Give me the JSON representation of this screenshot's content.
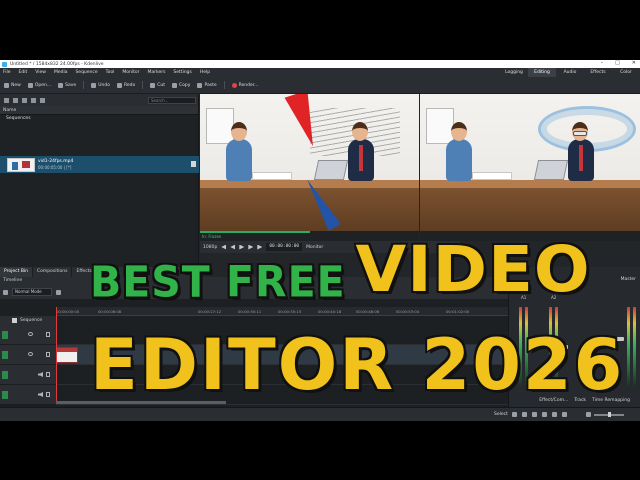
{
  "window": {
    "title": "Untitled * / 1584x832 24.00fps - Kdenlive",
    "controls": [
      "–",
      "□",
      "✕"
    ]
  },
  "menu": [
    "File",
    "Edit",
    "View",
    "Media",
    "Sequence",
    "Tool",
    "Monitor",
    "Markers",
    "Settings",
    "Help"
  ],
  "layouts": {
    "items": [
      "Logging",
      "Editing",
      "Audio",
      "Effects",
      "Color"
    ],
    "active": "Editing"
  },
  "toolbar": {
    "new": "New",
    "open": "Open...",
    "save": "Save",
    "undo": "Undo",
    "redo": "Redo",
    "cut": "Cut",
    "copy": "Copy",
    "paste": "Paste",
    "render": "Render...",
    "render_color": "#e0434b"
  },
  "bin": {
    "search_placeholder": "Search...",
    "column_header": "Name",
    "folder": "Sequences",
    "clip_name": "vid1-24fps.mp4",
    "clip_duration": "00:00:05:00 | [*]"
  },
  "dock_tabs": [
    "Project Bin",
    "Compositions",
    "Effects",
    "Clip Pr..."
  ],
  "monitor": {
    "clip_label": "In: Frozen",
    "progress": 0.5,
    "zoom": "1080p",
    "timecode": "00:00:00:00",
    "tab": "Monitor"
  },
  "timeline": {
    "title": "Timeline",
    "mode": "Normal Mode",
    "sequence": "Sequence",
    "ruler": [
      "00:00:00:00",
      "00:00:08:08",
      "00:00:27:12",
      "00:00:30:11",
      "00:00:35:15",
      "00:00:40:18",
      "00:00:48:06",
      "00:00:53:04",
      "00:01:02:00"
    ],
    "tracks": [
      "V2",
      "V1",
      "A1",
      "A2"
    ]
  },
  "mixer": {
    "title": "Master",
    "labels": [
      "A1",
      "A2"
    ]
  },
  "status": {
    "select": "Select",
    "zoom_value": 0.5
  },
  "right_tabs": [
    "Effect/Com...",
    "Track",
    "Time Remapping"
  ],
  "headline": {
    "line1": "BEST FREE",
    "line2": "VIDEO",
    "line3": "EDITOR 2026",
    "green": "#32b34a",
    "yellow": "#f1c21b"
  }
}
